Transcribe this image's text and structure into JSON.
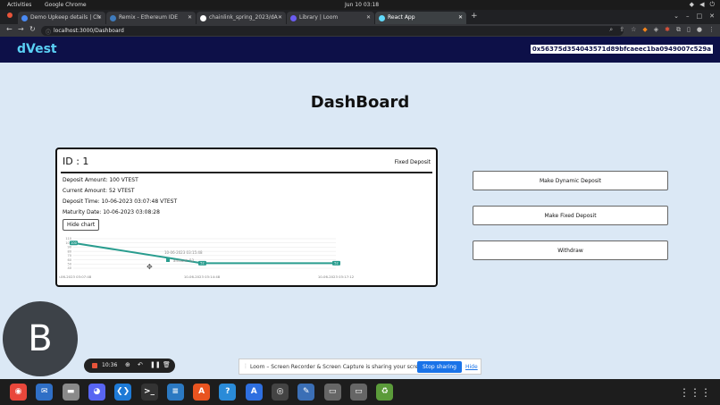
{
  "system": {
    "activities": "Activities",
    "app_name": "Google Chrome",
    "clock": "Jun 10  03:18"
  },
  "browser": {
    "tabs": [
      {
        "label": "Demo Upkeep details | Ch",
        "favicon_color": "#4a8af4"
      },
      {
        "label": "Remix - Ethereum IDE",
        "favicon_color": "#3e7bbd"
      },
      {
        "label": "chainlink_spring_2023/dA",
        "favicon_color": "#ffffff"
      },
      {
        "label": "Library | Loom",
        "favicon_color": "#6a5cf0"
      },
      {
        "label": "React App",
        "favicon_color": "#61dafb"
      }
    ],
    "url": "localhost:3000/Dashboard"
  },
  "app": {
    "logo": "dVest",
    "wallet_address": "0x56375d354043571d89bfcaeec1ba0949007c529a",
    "page_title": "DashBoard"
  },
  "deposit_card": {
    "id_label": "ID : 1",
    "type": "Fixed Deposit",
    "deposit_amount": "Deposit Amount: 100 VTEST",
    "current_amount": "Current Amount: 52 VTEST",
    "deposit_time": "Deposit Time: 10-06-2023 03:07:48 VTEST",
    "maturity_date": "Maturity Date: 10-06-2023 03:08:28",
    "hide_chart_label": "Hide chart"
  },
  "chart_data": {
    "type": "line",
    "x": [
      "10-06-2023 03:07:48",
      "10-06-2023 03:14:48",
      "10-06-2023 03:17:12"
    ],
    "values": [
      100,
      52,
      52
    ],
    "data_labels": [
      "100",
      "52",
      "52"
    ],
    "x_tick_labels": [
      "10-06-2023 03:07:48",
      "10-06-2023 03:14:48",
      "10-06-2023 03:17:12"
    ],
    "y_ticks": [
      "110",
      "100",
      "90",
      "80",
      "70",
      "60",
      "50",
      "40"
    ],
    "ylim": [
      40,
      110
    ],
    "tooltip_title": "10-06-2023 03:15:48",
    "tooltip_value": "amount: 52",
    "line_color": "#2a9d8f",
    "grid": true
  },
  "actions": {
    "dynamic_label": "Make Dynamic Deposit",
    "fixed_label": "Make Fixed Deposit",
    "withdraw_label": "Withdraw"
  },
  "loom": {
    "avatar_letter": "B",
    "timer": "10:36",
    "share_message": "Loom – Screen Recorder & Screen Capture is sharing your screen.",
    "stop_label": "Stop sharing",
    "hide_label": "Hide"
  },
  "dock": {
    "items": [
      {
        "name": "chrome",
        "glyph": "◉",
        "color": "#e9473b"
      },
      {
        "name": "thunderbird",
        "glyph": "✉",
        "color": "#2f6fc6"
      },
      {
        "name": "files",
        "glyph": "▬",
        "color": "#8a8a8a"
      },
      {
        "name": "discord",
        "glyph": "◕",
        "color": "#5865f2"
      },
      {
        "name": "vscode",
        "glyph": "❮❯",
        "color": "#1e7ad6"
      },
      {
        "name": "terminal",
        "glyph": ">_",
        "color": "#333333"
      },
      {
        "name": "libreoffice-writer",
        "glyph": "≡",
        "color": "#2b79c2"
      },
      {
        "name": "software",
        "glyph": "A",
        "color": "#e95420"
      },
      {
        "name": "help",
        "glyph": "?",
        "color": "#2a8bd8"
      },
      {
        "name": "app-store",
        "glyph": "A",
        "color": "#2e6fe0"
      },
      {
        "name": "obs",
        "glyph": "◎",
        "color": "#444444"
      },
      {
        "name": "text-editor",
        "glyph": "✎",
        "color": "#3b6fb6"
      },
      {
        "name": "disk",
        "glyph": "▭",
        "color": "#666666"
      },
      {
        "name": "disk-2",
        "glyph": "▭",
        "color": "#666666"
      },
      {
        "name": "trash",
        "glyph": "♻",
        "color": "#5b9b3a"
      }
    ]
  }
}
